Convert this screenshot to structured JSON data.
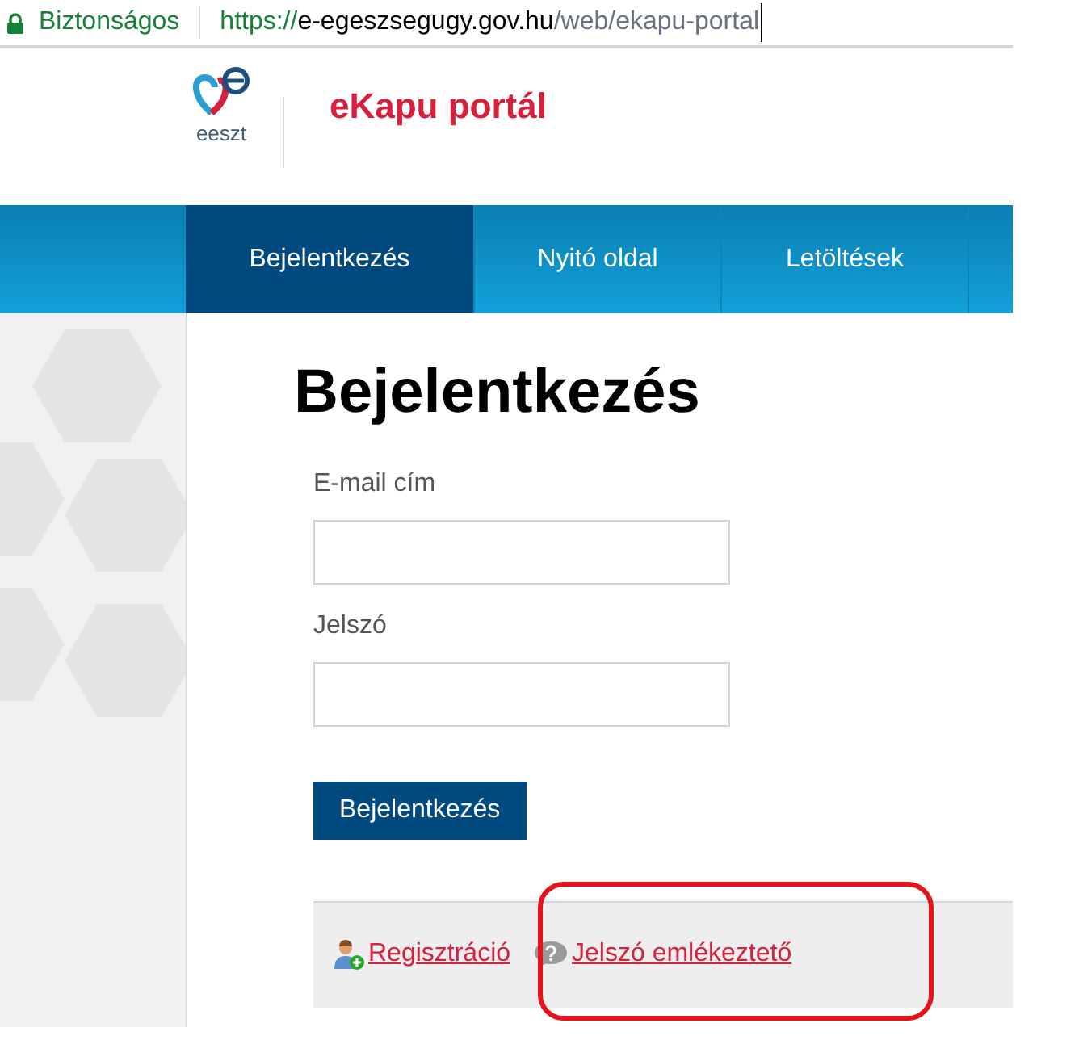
{
  "address_bar": {
    "security_label": "Biztonságos",
    "url_scheme": "https://",
    "url_host": "e-egeszsegugy.gov.hu",
    "url_path": "/web/ekapu-portal"
  },
  "header": {
    "logo_text": "eeszt",
    "title": "eKapu portál"
  },
  "nav": [
    {
      "label": "Bejelentkezés",
      "selected": true
    },
    {
      "label": "Nyitó oldal",
      "selected": false
    },
    {
      "label": "Letöltések",
      "selected": false
    }
  ],
  "form": {
    "heading": "Bejelentkezés",
    "fields": [
      {
        "label": "E-mail cím"
      },
      {
        "label": "Jelszó"
      }
    ],
    "submit": "Bejelentkezés"
  },
  "footer_links": [
    {
      "kind": "register",
      "label": "Regisztráció"
    },
    {
      "kind": "help",
      "label": "Jelszó emlékeztető"
    }
  ]
}
